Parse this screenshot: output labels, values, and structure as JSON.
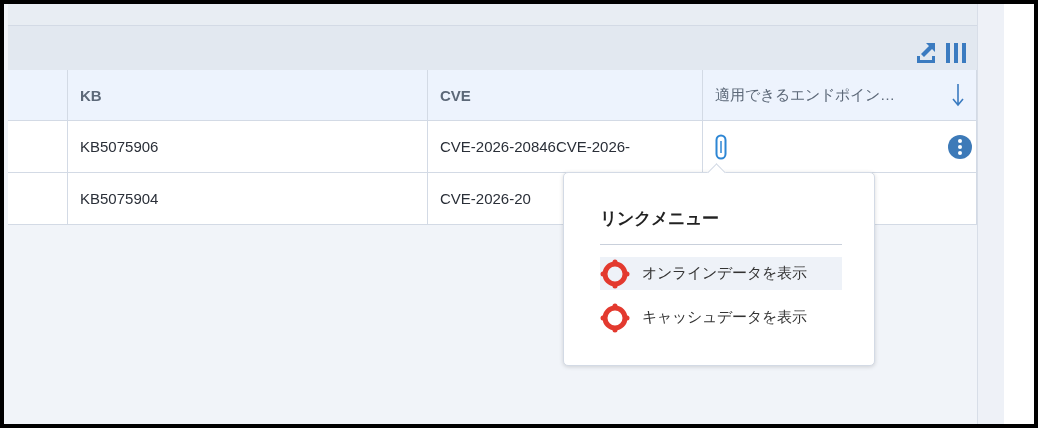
{
  "table": {
    "columns": [
      {
        "label": "KB"
      },
      {
        "label": "CVE"
      },
      {
        "label": "適用できるエンドポイン…"
      }
    ],
    "rows": [
      {
        "kb": "KB5075906",
        "cve": "CVE-2026-20846CVE-2026-",
        "attachment": true,
        "actions": true
      },
      {
        "kb": "KB5075904",
        "cve": "CVE-2026-20"
      }
    ]
  },
  "link_menu": {
    "title": "リンクメニュー",
    "items": [
      {
        "label": "オンラインデータを表示",
        "selected": true
      },
      {
        "label": "キャッシュデータを表示",
        "selected": false
      }
    ]
  }
}
